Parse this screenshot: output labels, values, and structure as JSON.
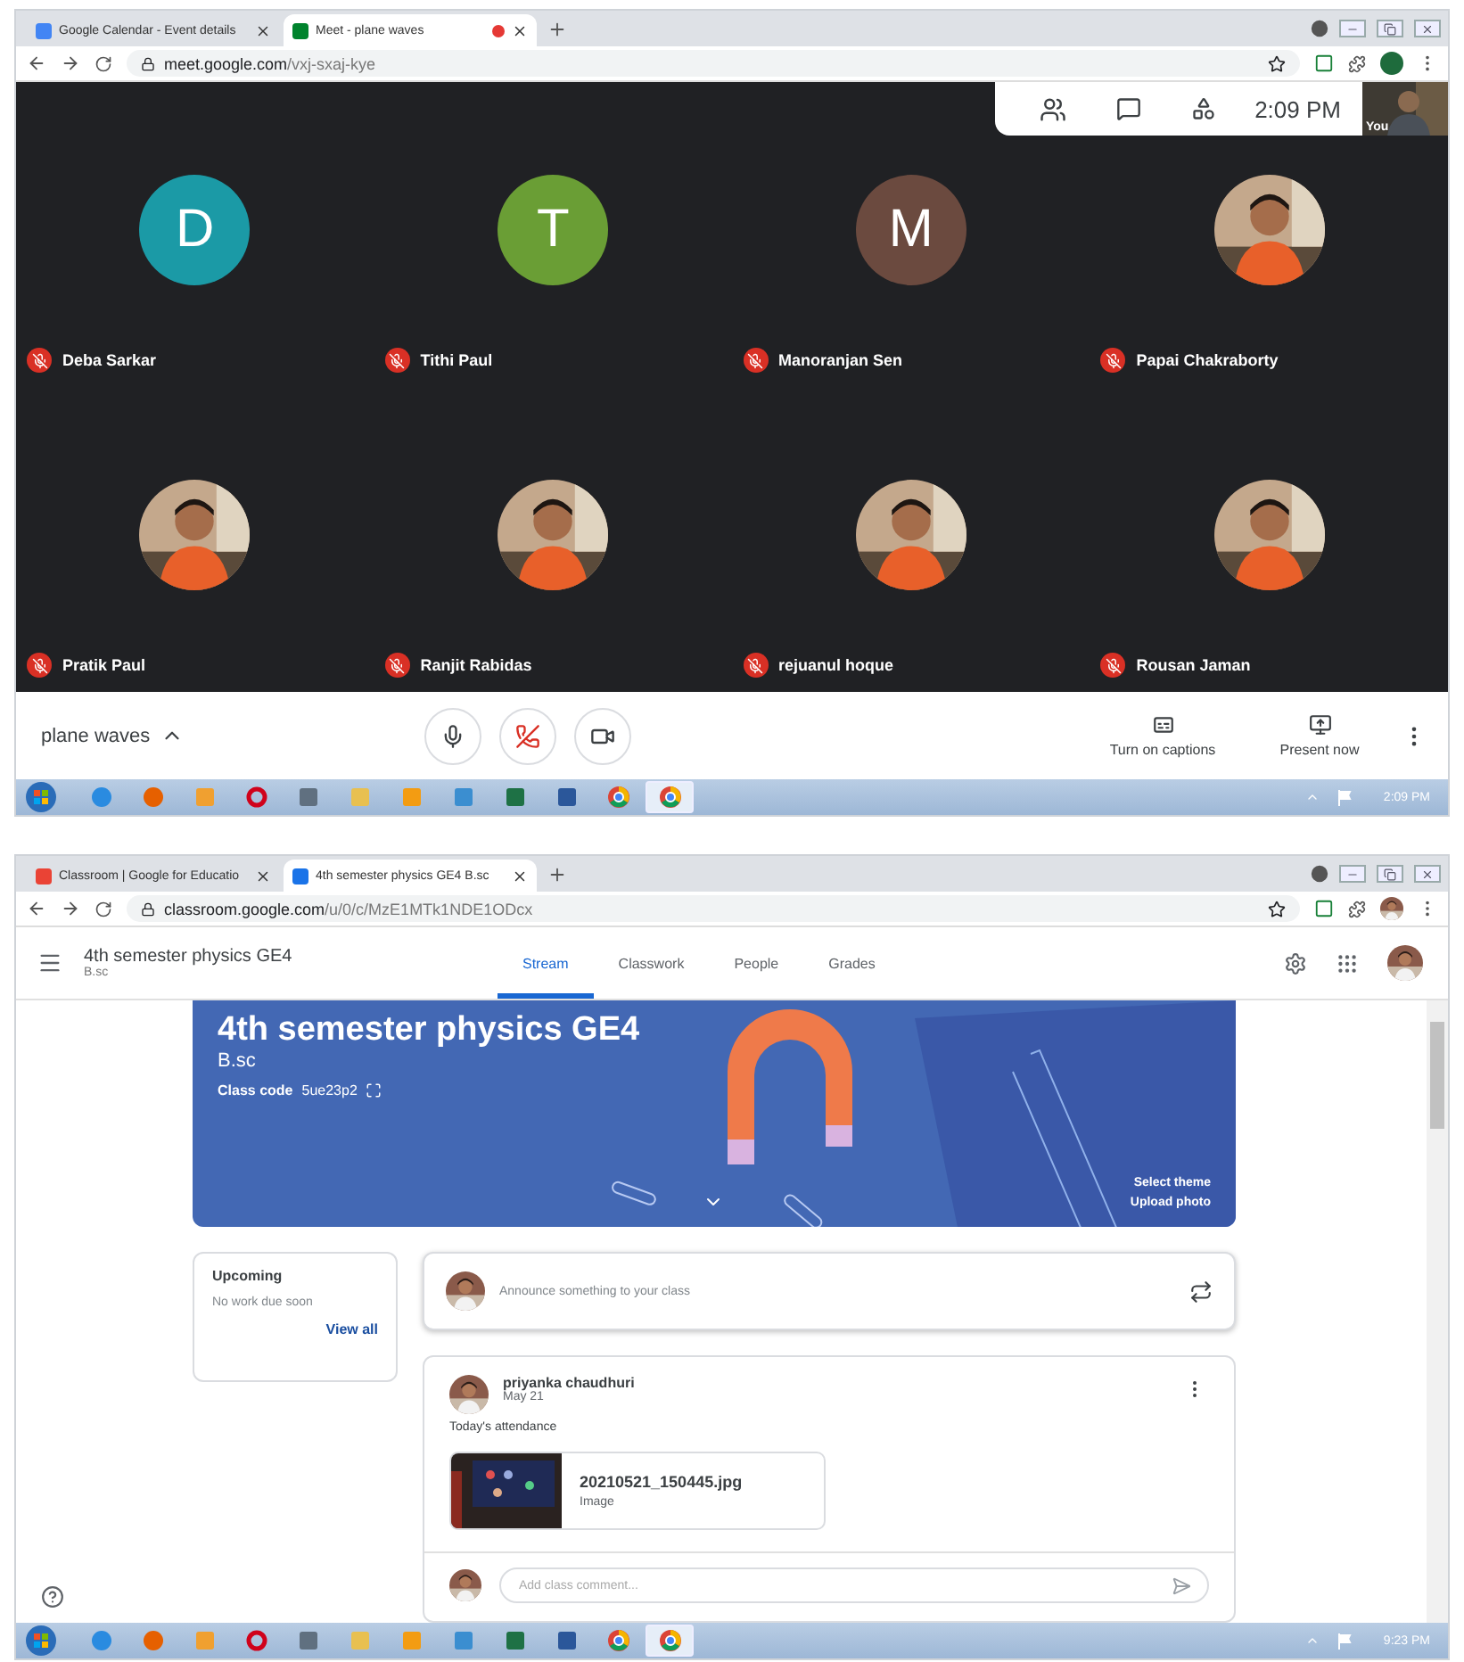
{
  "meet_window": {
    "tabs": [
      {
        "label": "Google Calendar - Event details",
        "kind": "calendar",
        "selected": false,
        "recording": false
      },
      {
        "label": "Meet - plane waves",
        "kind": "meet",
        "selected": true,
        "recording": true
      }
    ],
    "url_host": "meet.google.com",
    "url_path": "/vxj-sxaj-kye",
    "clock": "2:09 PM",
    "self_label": "You",
    "participants": [
      {
        "name": "Deba Sarkar",
        "kind": "initial",
        "initial": "D",
        "color": "#1b9aa6",
        "muted": true
      },
      {
        "name": "Tithi Paul",
        "kind": "initial",
        "initial": "T",
        "color": "#6a9e35",
        "muted": true
      },
      {
        "name": "Manoranjan Sen",
        "kind": "initial",
        "initial": "M",
        "color": "#6b4a3f",
        "muted": true
      },
      {
        "name": "Papai Chakraborty",
        "kind": "picture",
        "muted": true
      },
      {
        "name": "Pratik Paul",
        "kind": "picture",
        "muted": true
      },
      {
        "name": "Ranjit Rabidas",
        "kind": "picture",
        "muted": true
      },
      {
        "name": "rejuanul hoque",
        "kind": "picture",
        "muted": true
      },
      {
        "name": "Rousan Jaman",
        "kind": "picture",
        "muted": true
      }
    ],
    "meeting_name": "plane waves",
    "captions_label": "Turn on captions",
    "present_label": "Present now"
  },
  "meet_taskbar": {
    "clock": "2:09 PM",
    "apps": [
      {
        "kind": "ie",
        "selected": false
      },
      {
        "kind": "firefox",
        "selected": false
      },
      {
        "kind": "paint",
        "selected": false
      },
      {
        "kind": "opera",
        "selected": false
      },
      {
        "kind": "calculator",
        "selected": false
      },
      {
        "kind": "folder",
        "selected": false
      },
      {
        "kind": "media",
        "selected": false
      },
      {
        "kind": "photos",
        "selected": false
      },
      {
        "kind": "excel",
        "selected": false
      },
      {
        "kind": "word",
        "selected": false
      },
      {
        "kind": "chrome",
        "selected": false
      },
      {
        "kind": "chrome",
        "selected": true
      }
    ]
  },
  "classroom_window": {
    "tabs": [
      {
        "label": "Classroom | Google for Educatio",
        "kind": "google",
        "selected": false,
        "recording": false
      },
      {
        "label": "4th semester physics GE4 B.sc",
        "kind": "classroom",
        "selected": true,
        "recording": false
      }
    ],
    "url_host": "classroom.google.com",
    "url_path": "/u/0/c/MzE1MTk1NDE1ODcx",
    "class_title": "4th semester physics GE4",
    "section": "B.sc",
    "nav": [
      {
        "label": "Stream",
        "selected": true
      },
      {
        "label": "Classwork",
        "selected": false
      },
      {
        "label": "People",
        "selected": false
      },
      {
        "label": "Grades",
        "selected": false
      }
    ],
    "banner": {
      "title": "4th semester physics GE4",
      "section": "B.sc",
      "code_label": "Class code",
      "code": "5ue23p2",
      "select_theme": "Select theme",
      "upload_photo": "Upload photo"
    },
    "upcoming": {
      "title": "Upcoming",
      "empty": "No work due soon",
      "link": "View all"
    },
    "announce_placeholder": "Announce something to your class",
    "post": {
      "author": "priyanka chaudhuri",
      "date": "May 21",
      "text": "Today's attendance",
      "attachment": {
        "name": "20210521_150445.jpg",
        "type": "Image"
      }
    },
    "comment_placeholder": "Add class comment..."
  },
  "classroom_taskbar": {
    "clock": "9:23 PM",
    "apps": [
      {
        "kind": "ie",
        "selected": false
      },
      {
        "kind": "firefox",
        "selected": false
      },
      {
        "kind": "paint",
        "selected": false
      },
      {
        "kind": "opera",
        "selected": false
      },
      {
        "kind": "calculator",
        "selected": false
      },
      {
        "kind": "folder",
        "selected": false
      },
      {
        "kind": "media",
        "selected": false
      },
      {
        "kind": "photos",
        "selected": false
      },
      {
        "kind": "excel",
        "selected": false
      },
      {
        "kind": "word",
        "selected": false
      },
      {
        "kind": "chrome",
        "selected": false
      },
      {
        "kind": "chrome",
        "selected": true
      }
    ]
  }
}
